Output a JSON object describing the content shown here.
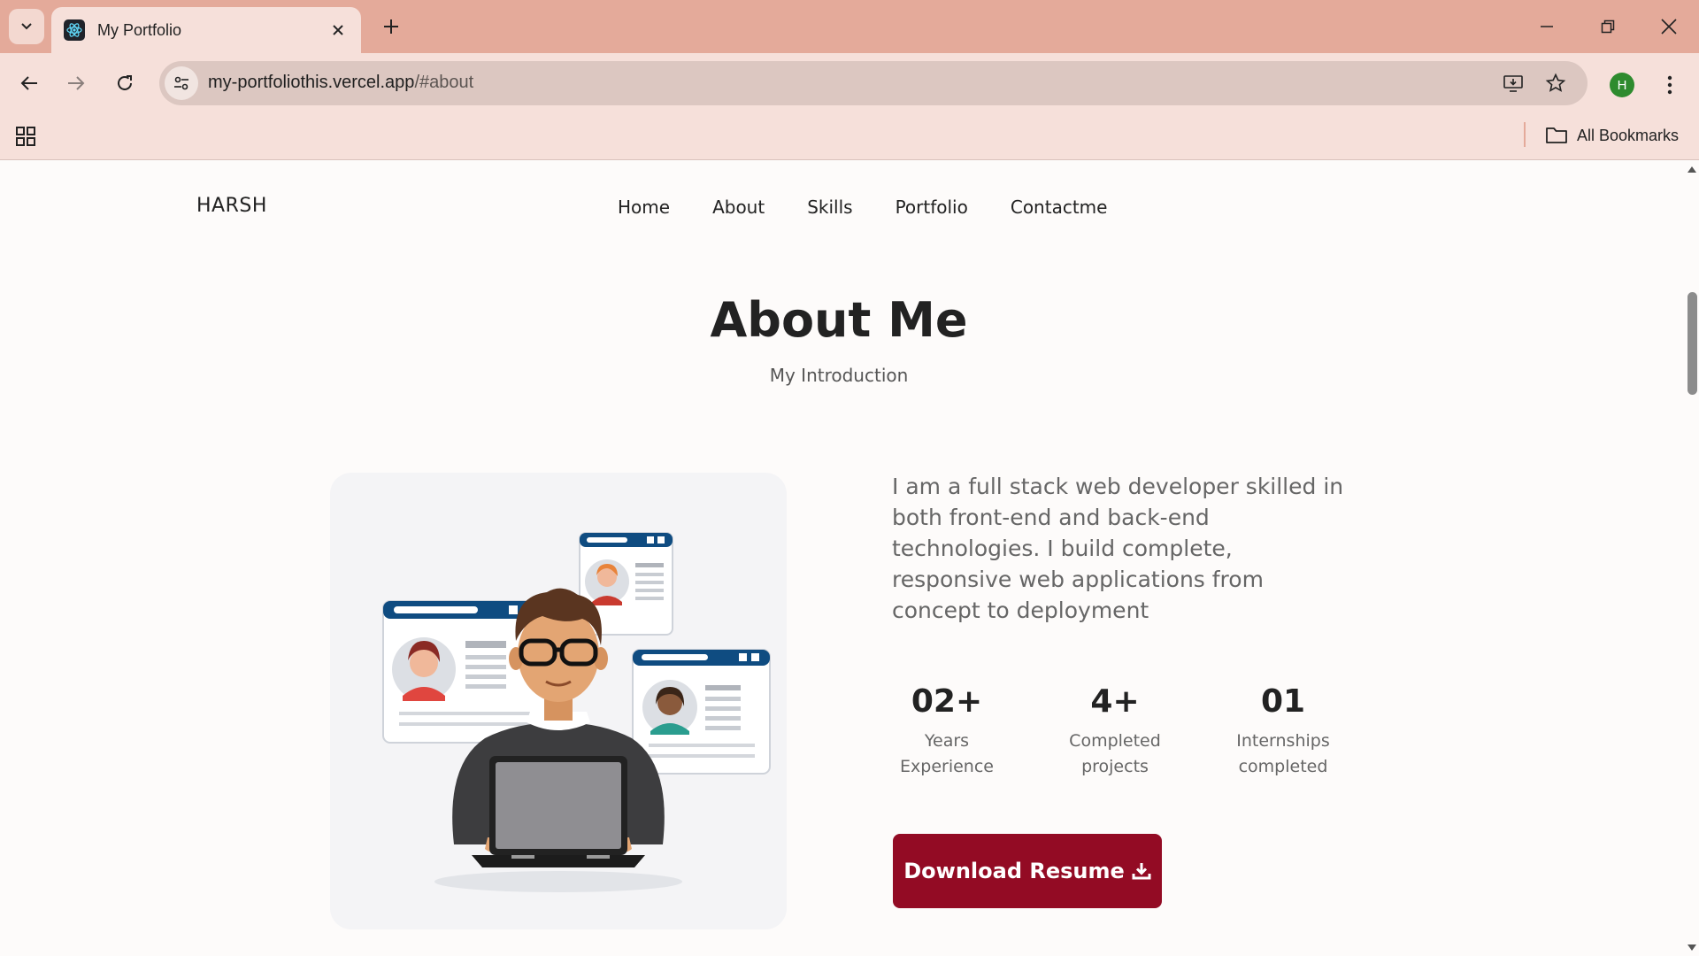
{
  "browser": {
    "tab_title": "My Portfolio",
    "url_host": "my-portfoliothis.vercel.app",
    "url_path": "/#about",
    "profile_initial": "H",
    "all_bookmarks_label": "All Bookmarks",
    "colors": {
      "frame": "#e4aa9a",
      "toolbar": "#f6e0da",
      "omnibox": "#dcc7c1",
      "profile": "#2e8b2e"
    }
  },
  "site": {
    "logo": "HARSH",
    "nav": [
      "Home",
      "About",
      "Skills",
      "Portfolio",
      "Contactme"
    ],
    "about": {
      "title": "About Me",
      "subtitle": "My Introduction",
      "intro": "I am a full stack web developer skilled in both front-end and back-end technologies. I build complete, responsive web applications from concept to deployment",
      "stats": [
        {
          "value": "02+",
          "label_line1": "Years",
          "label_line2": "Experience"
        },
        {
          "value": "4+",
          "label_line1": "Completed",
          "label_line2": "projects"
        },
        {
          "value": "01",
          "label_line1": "Internships",
          "label_line2": "completed"
        }
      ],
      "download_label": "Download Resume"
    },
    "colors": {
      "accent": "#930b24",
      "text": "#222222",
      "muted": "#666666",
      "card": "#f4f4f6"
    }
  }
}
